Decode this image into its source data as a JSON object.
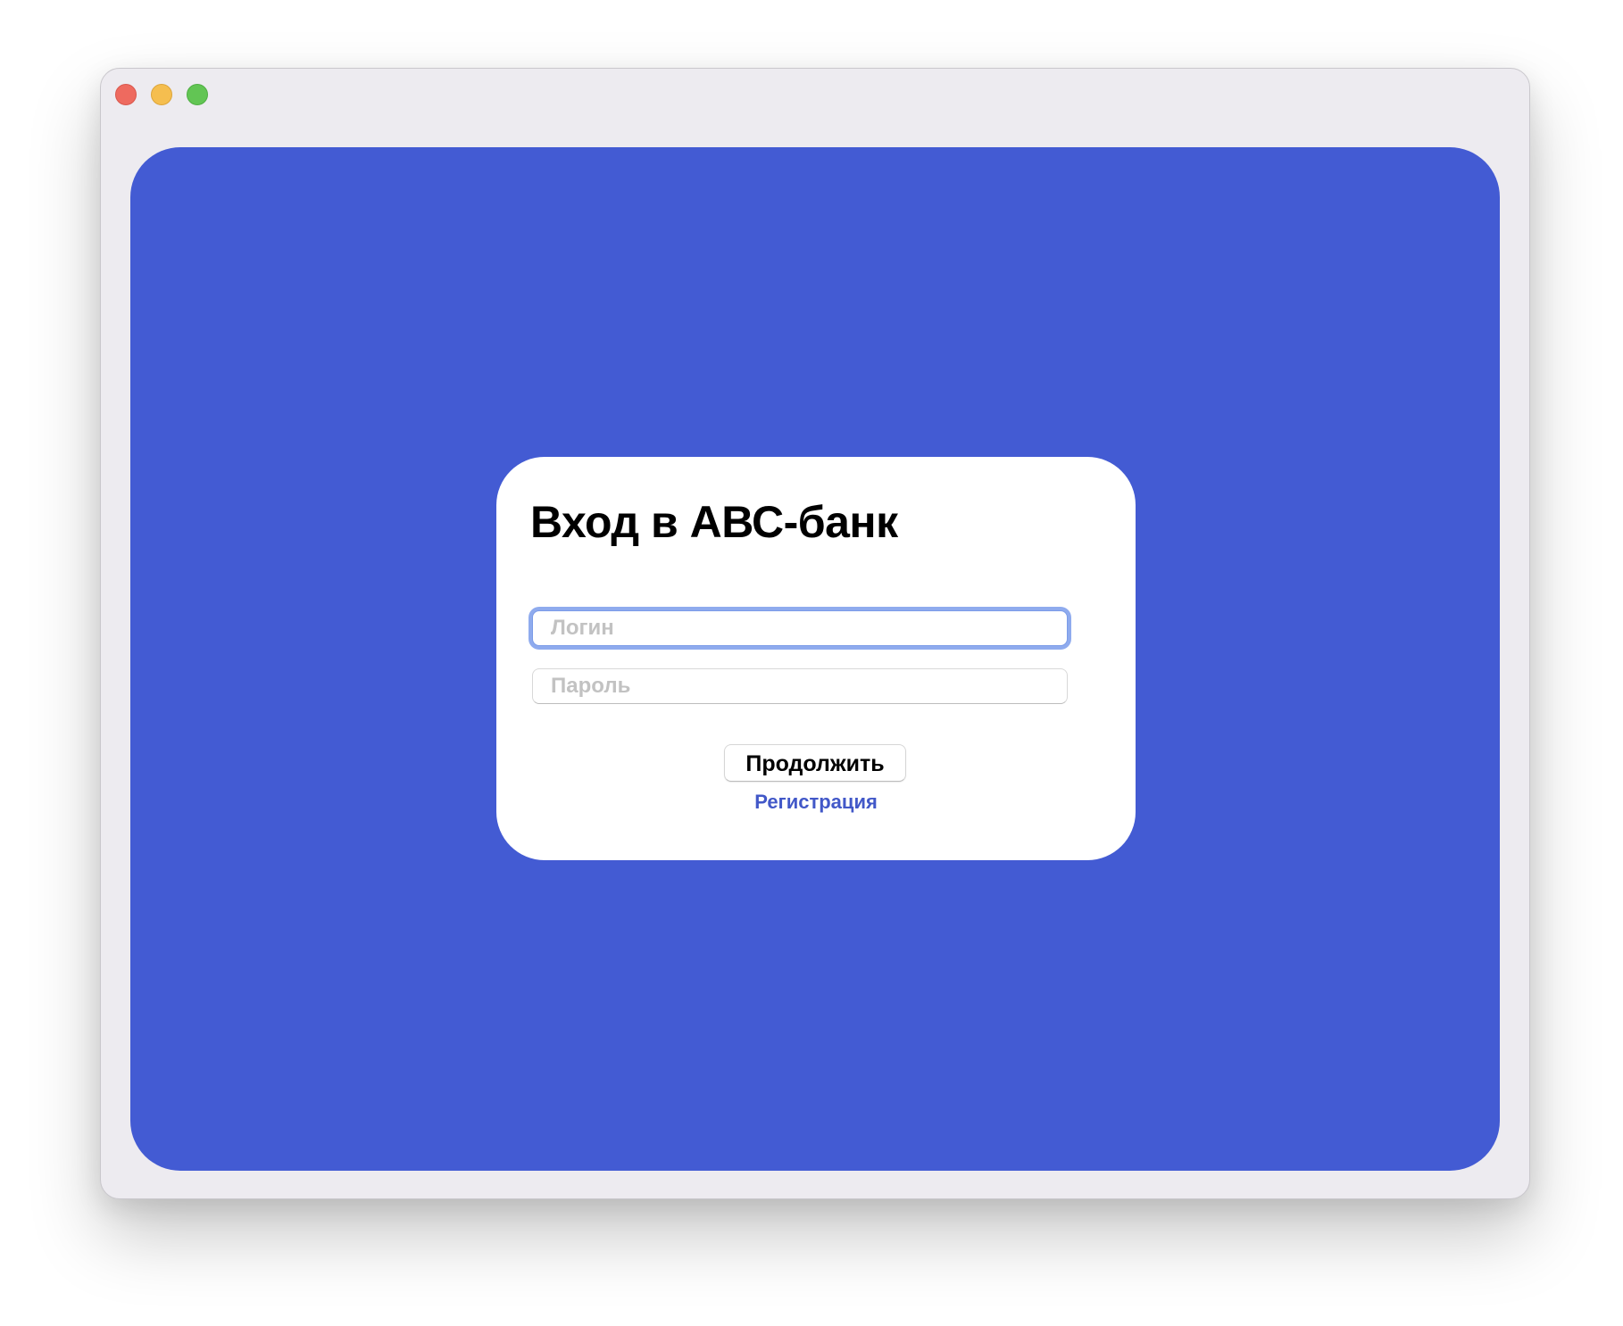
{
  "window": {
    "traffic_lights": [
      "close",
      "minimize",
      "zoom"
    ]
  },
  "colors": {
    "background": "#435bd3",
    "card": "#ffffff",
    "link": "#4258c8",
    "focus_ring": "#8fabee"
  },
  "login_card": {
    "title": "Вход в АВС-банк",
    "login_placeholder": "Логин",
    "login_value": "",
    "password_placeholder": "Пароль",
    "password_value": "",
    "submit_label": "Продолжить",
    "register_link": "Регистрация"
  }
}
